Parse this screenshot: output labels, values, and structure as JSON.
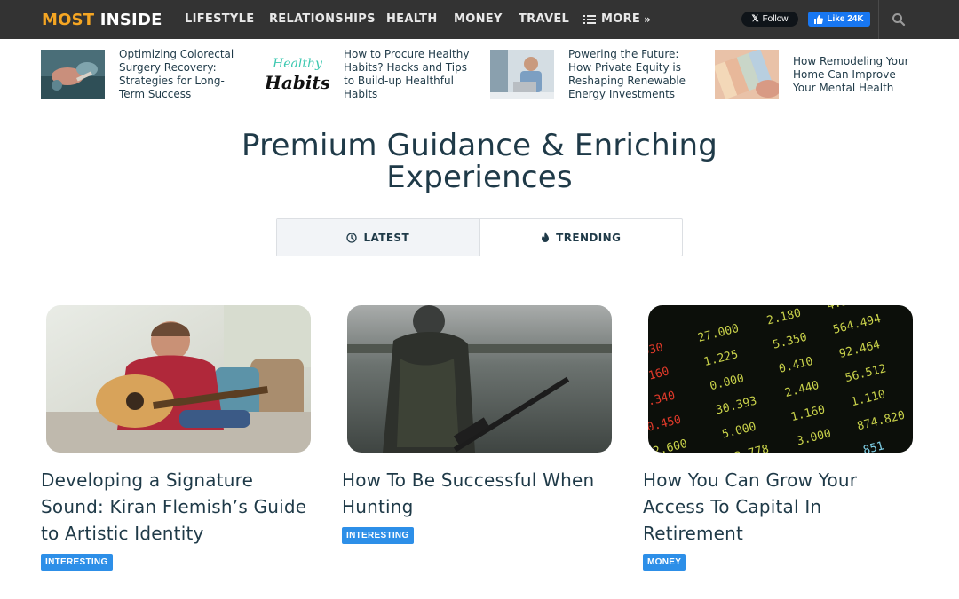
{
  "brand": {
    "part1": "MOST",
    "part2": "INSIDE"
  },
  "nav": {
    "items": [
      "LIFESTYLE",
      "RELATIONSHIPS",
      "HEALTH",
      "MONEY",
      "TRAVEL"
    ],
    "more_label": "MORE",
    "x_follow_label": "Follow",
    "fb_like_label": "Like 24K"
  },
  "featured": [
    {
      "title": "Optimizing Colorectal Surgery Recovery: Strategies for Long-Term Success",
      "image": "surgery-photo"
    },
    {
      "title": "How to Procure Healthy Habits? Hacks and Tips to Build-up Healthful Habits",
      "image": "healthy-habits-logo",
      "image_text_top": "Healthy",
      "image_text_bottom": "Habits"
    },
    {
      "title": "Powering the Future: How Private Equity is Reshaping Renewable Energy Investments",
      "image": "businessman-laptop-photo"
    },
    {
      "title": "How Remodeling Your Home Can Improve Your Mental Health",
      "image": "color-swatches-photo"
    }
  ],
  "headline": "Premium Guidance & Enriching Experiences",
  "tabs": [
    {
      "label": "LATEST",
      "icon": "clock-icon",
      "active": true
    },
    {
      "label": "TRENDING",
      "icon": "flame-icon",
      "active": false
    }
  ],
  "cards": [
    {
      "title": "Developing a Signature Sound: Kiran Flemish’s Guide to Artistic Identity",
      "badge": "INTERESTING",
      "image": "guitar-player-photo"
    },
    {
      "title": "How To Be Successful When Hunting",
      "badge": "INTERESTING",
      "image": "hunter-photo"
    },
    {
      "title": "How You Can Grow Your Access To Capital In Retirement",
      "badge": "MONEY",
      "image": "stock-board-photo"
    }
  ],
  "colors": {
    "nav_bg": "#333333",
    "brand_accent": "#f5a623",
    "text": "#1f3a48",
    "badge": "#2d8fe8",
    "fb": "#1877f2"
  }
}
